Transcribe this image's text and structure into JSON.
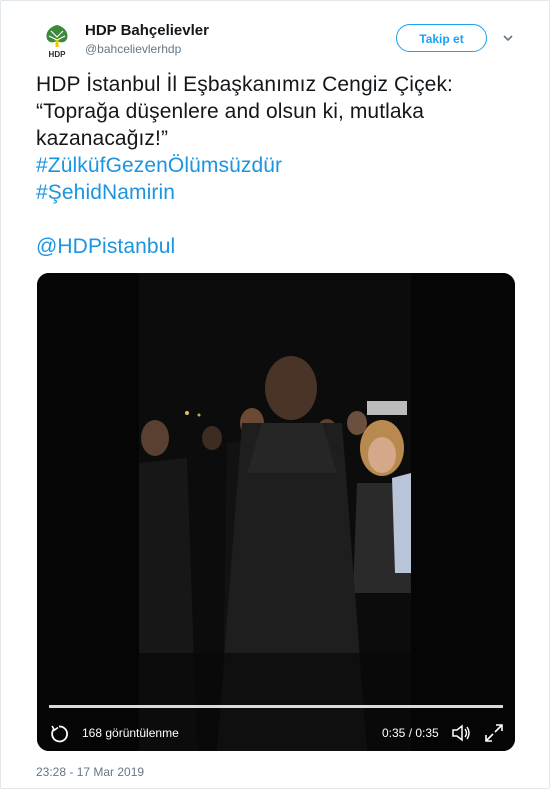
{
  "user": {
    "name": "HDP Bahçelievler",
    "handle": "@bahcelievlerhdp",
    "avatar_text": "HDP"
  },
  "follow_label": "Takip et",
  "tweet": {
    "line1": "HDP İstanbul İl Eşbaşkanımız Cengiz Çiçek:",
    "line2": "“Toprağa düşenlere and olsun ki, mutlaka",
    "line3": "kazanacağız!”",
    "hashtag1": "#ZülküfGezenÖlümsüzdür",
    "hashtag2": "#ŞehidNamirin",
    "mention": "@HDPistanbul"
  },
  "video": {
    "views": "168 görüntülenme",
    "time": "0:35 / 0:35",
    "progress": 1.0
  },
  "timestamp": "23:28 - 17 Mar 2019",
  "colors": {
    "link": "#1b95e0",
    "follow": "#1da1f2",
    "logo_green": "#3a8a3a",
    "logo_yellow": "#f2c400"
  },
  "icons": [
    "hdp-logo-icon",
    "chevron-down-icon",
    "replay-icon",
    "volume-icon",
    "fullscreen-icon"
  ]
}
